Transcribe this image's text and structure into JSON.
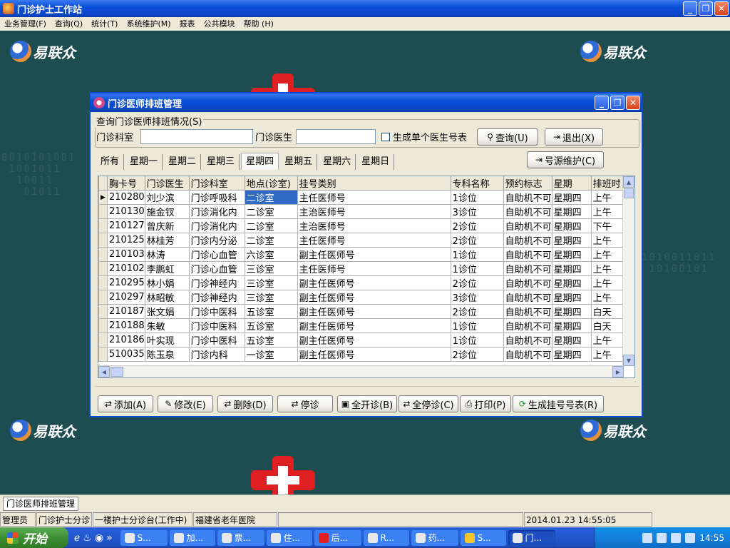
{
  "app": {
    "title": "门诊护士工作站",
    "controls": {
      "minimize": "_",
      "restore": "❐",
      "close": "✕"
    }
  },
  "menu": [
    "业务管理(F)",
    "查询(Q)",
    "统计(T)",
    "系统维护(M)",
    "报表",
    "公共模块",
    "帮助 (H)"
  ],
  "desktop": {
    "logo_text": "易联众",
    "binary_left": "0010101001\n 1001011\n  10011\n   01011",
    "binary_right": "1010011011\n 10100101"
  },
  "dialog": {
    "title": "门诊医师排班管理",
    "query": {
      "legend": "查询门诊医师排班情况(S)",
      "dept_label": "门诊科室",
      "dept_value": "",
      "doctor_label": "门诊医生",
      "doctor_value": "",
      "single_label": "生成单个医生号表",
      "query_button": "查询(U)",
      "exit_button": "退出(X)"
    },
    "tabs": [
      "所有",
      "星期一",
      "星期二",
      "星期三",
      "星期四",
      "星期五",
      "星期六",
      "星期日"
    ],
    "active_tab": 4,
    "source_button": "号源维护(C)",
    "columns": [
      "胸卡号",
      "门诊医生",
      "门诊科室",
      "地点(诊室)",
      "挂号类别",
      "专科名称",
      "预约标志",
      "星期",
      "排班时"
    ],
    "rows": [
      [
        "210280",
        "刘少滨",
        "门诊呼吸科",
        "二诊室",
        "主任医师号",
        "1诊位",
        "自助机不可",
        "星期四",
        "上午"
      ],
      [
        "210130",
        "施金钗",
        "门诊消化内",
        "二诊室",
        "主治医师号",
        "3诊位",
        "自助机不可",
        "星期四",
        "上午"
      ],
      [
        "210127",
        "曾庆新",
        "门诊消化内",
        "二诊室",
        "主治医师号",
        "2诊位",
        "自助机不可",
        "星期四",
        "下午"
      ],
      [
        "210125",
        "林桂芳",
        "门诊内分泌",
        "二诊室",
        "主任医师号",
        "2诊位",
        "自助机不可",
        "星期四",
        "上午"
      ],
      [
        "210103",
        "林涛",
        "门诊心血管",
        "六诊室",
        "副主任医师号",
        "1诊位",
        "自助机不可",
        "星期四",
        "上午"
      ],
      [
        "210102",
        "李鹏虹",
        "门诊心血管",
        "三诊室",
        "主任医师号",
        "1诊位",
        "自助机不可",
        "星期四",
        "上午"
      ],
      [
        "210295",
        "林小娟",
        "门诊神经内",
        "三诊室",
        "副主任医师号",
        "2诊位",
        "自助机不可",
        "星期四",
        "上午"
      ],
      [
        "210297",
        "林昭敏",
        "门诊神经内",
        "三诊室",
        "副主任医师号",
        "3诊位",
        "自助机不可",
        "星期四",
        "上午"
      ],
      [
        "210187",
        "张文娟",
        "门诊中医科",
        "五诊室",
        "副主任医师号",
        "2诊位",
        "自助机不可",
        "星期四",
        "白天"
      ],
      [
        "210188",
        "朱敏",
        "门诊中医科",
        "五诊室",
        "副主任医师号",
        "1诊位",
        "自助机不可",
        "星期四",
        "白天"
      ],
      [
        "210186",
        "叶实现",
        "门诊中医科",
        "五诊室",
        "副主任医师号",
        "1诊位",
        "自助机不可",
        "星期四",
        "上午"
      ],
      [
        "510035",
        "陈玉泉",
        "门诊内科",
        "一诊室",
        "副主任医师号",
        "2诊位",
        "自助机不可",
        "星期四",
        "上午"
      ]
    ],
    "actions": [
      "添加(A)",
      "修改(E)",
      "删除(D)",
      "停诊",
      "全开诊(B)",
      "全停诊(C)",
      "打印(P)",
      "生成挂号号表(R)"
    ]
  },
  "mdi_tab": "门诊医师排班管理",
  "status": [
    "管理员",
    "门诊护士分诊",
    "一楼护士分诊台(工作中)",
    "福建省老年医院",
    "",
    "2014.01.23 14:55:05"
  ],
  "taskbar": {
    "start": "开始",
    "quick_more": "»",
    "tasks": [
      "S...",
      "加...",
      "票...",
      "住...",
      "后...",
      "R...",
      "药...",
      "S...",
      "门..."
    ],
    "clock": "14:55"
  }
}
